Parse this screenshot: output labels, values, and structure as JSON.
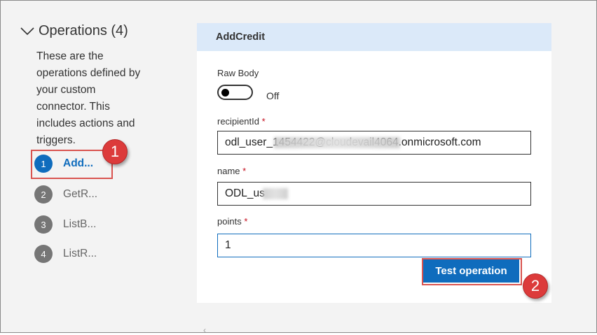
{
  "sidebar": {
    "title": "Operations (4)",
    "description": "These are the operations defined by your custom connector. This includes actions and triggers.",
    "operations": [
      {
        "number": "1",
        "label": "Add...",
        "active": true
      },
      {
        "number": "2",
        "label": "GetR...",
        "active": false
      },
      {
        "number": "3",
        "label": "ListB...",
        "active": false
      },
      {
        "number": "4",
        "label": "ListR...",
        "active": false
      }
    ]
  },
  "operation": {
    "title": "AddCredit",
    "raw_body": {
      "label": "Raw Body",
      "state": "Off"
    },
    "fields": [
      {
        "label": "recipientId",
        "required_marker": "*",
        "value": "odl_user_1454422@cloudevail4064.onmicrosoft.com"
      },
      {
        "label": "name",
        "required_marker": "*",
        "value": "ODL_us"
      },
      {
        "label": "points",
        "required_marker": "*",
        "value": "1"
      }
    ],
    "test_button": "Test operation"
  },
  "callouts": [
    "1",
    "2"
  ],
  "colors": {
    "accent": "#0f6cbd",
    "header_bg": "#dbe9f9",
    "callout": "#dc3b3b",
    "required": "#c50f1f"
  },
  "icons": {
    "collapse": "chevron-down-icon"
  }
}
